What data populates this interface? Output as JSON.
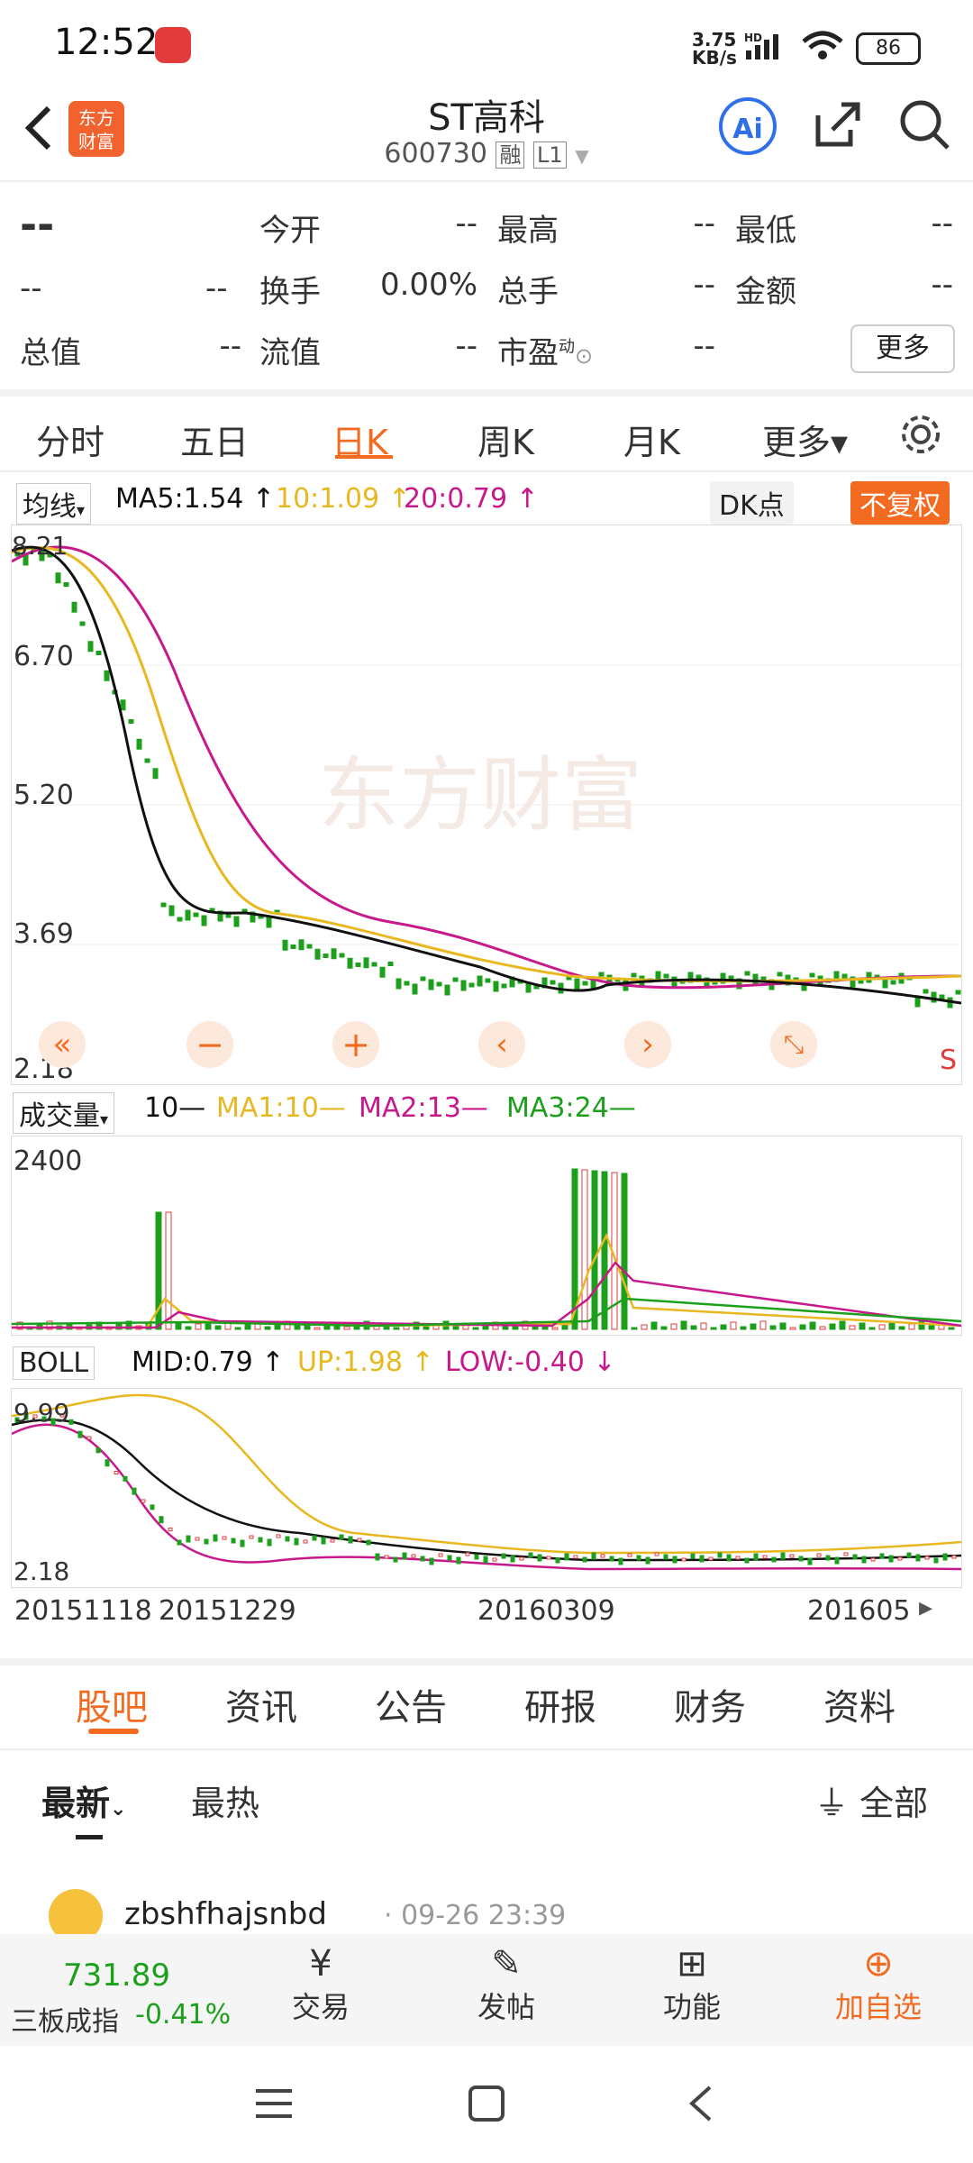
{
  "status_bar": {
    "time": "12:52",
    "net_speed": "3.75\nKB/s",
    "battery": "86"
  },
  "header": {
    "title": "ST高科",
    "code": "600730",
    "tag1": "融",
    "tag2": "L1",
    "logo": "东方\n财富",
    "ai": "Ai"
  },
  "quote": {
    "price": "--",
    "change": "--",
    "change2": "--",
    "rows": [
      [
        {
          "k": "今开",
          "v": "--"
        },
        {
          "k": "最高",
          "v": "--"
        },
        {
          "k": "最低",
          "v": "--"
        }
      ],
      [
        {
          "k": "换手",
          "v": "0.00%"
        },
        {
          "k": "总手",
          "v": "--"
        },
        {
          "k": "金额",
          "v": "--"
        }
      ],
      [
        {
          "k": "流值",
          "v": "--"
        },
        {
          "k": "市盈",
          "v": "--"
        }
      ]
    ],
    "total_label": "总值",
    "total_val": "--",
    "pe_sup": "动",
    "more": "更多"
  },
  "period_tabs": [
    "分时",
    "五日",
    "日K",
    "周K",
    "月K",
    "更多▾"
  ],
  "main_chart": {
    "ma_label": "均线",
    "ma5": "MA5:1.54 ↑",
    "ma10": "10:1.09 ↑",
    "ma20": "20:0.79 ↑",
    "dk": "DK点",
    "fq": "不复权",
    "y_ticks": [
      "6.70",
      "5.20",
      "3.69",
      "2.18"
    ],
    "top_tick": "8.21",
    "watermark": "东方财富",
    "s_mark": "S"
  },
  "volume_chart": {
    "label": "成交量",
    "ma": "10—",
    "ma1": "MA1:10—",
    "ma2": "MA2:13—",
    "ma3": "MA3:24—",
    "ymax": "2400"
  },
  "boll_chart": {
    "label": "BOLL",
    "mid": "MID:0.79 ↑",
    "up": "UP:1.98 ↑",
    "low": "LOW:-0.40 ↓",
    "top": "9.99",
    "bottom": "2.18"
  },
  "x_axis": [
    "20151118",
    "20151229",
    "20160309",
    "201605"
  ],
  "news_tabs": [
    "股吧",
    "资讯",
    "公告",
    "研报",
    "财务",
    "资料"
  ],
  "sort_tabs": {
    "latest": "最新",
    "hot": "最热",
    "filter": "全部"
  },
  "post": {
    "user": "zbshfhajsnbd",
    "time": "· 09-26 23:39"
  },
  "bottom_bar": {
    "index_value": "731.89",
    "index_name": "三板成指",
    "index_change": "-0.41%",
    "trade": "交易",
    "post": "发帖",
    "func": "功能",
    "add": "加自选"
  },
  "colors": {
    "accent": "#f26b21",
    "up": "#e23b3b",
    "down": "#1ca01c",
    "ma5": "#000000",
    "ma10": "#e8b820",
    "ma20": "#c8198c"
  }
}
